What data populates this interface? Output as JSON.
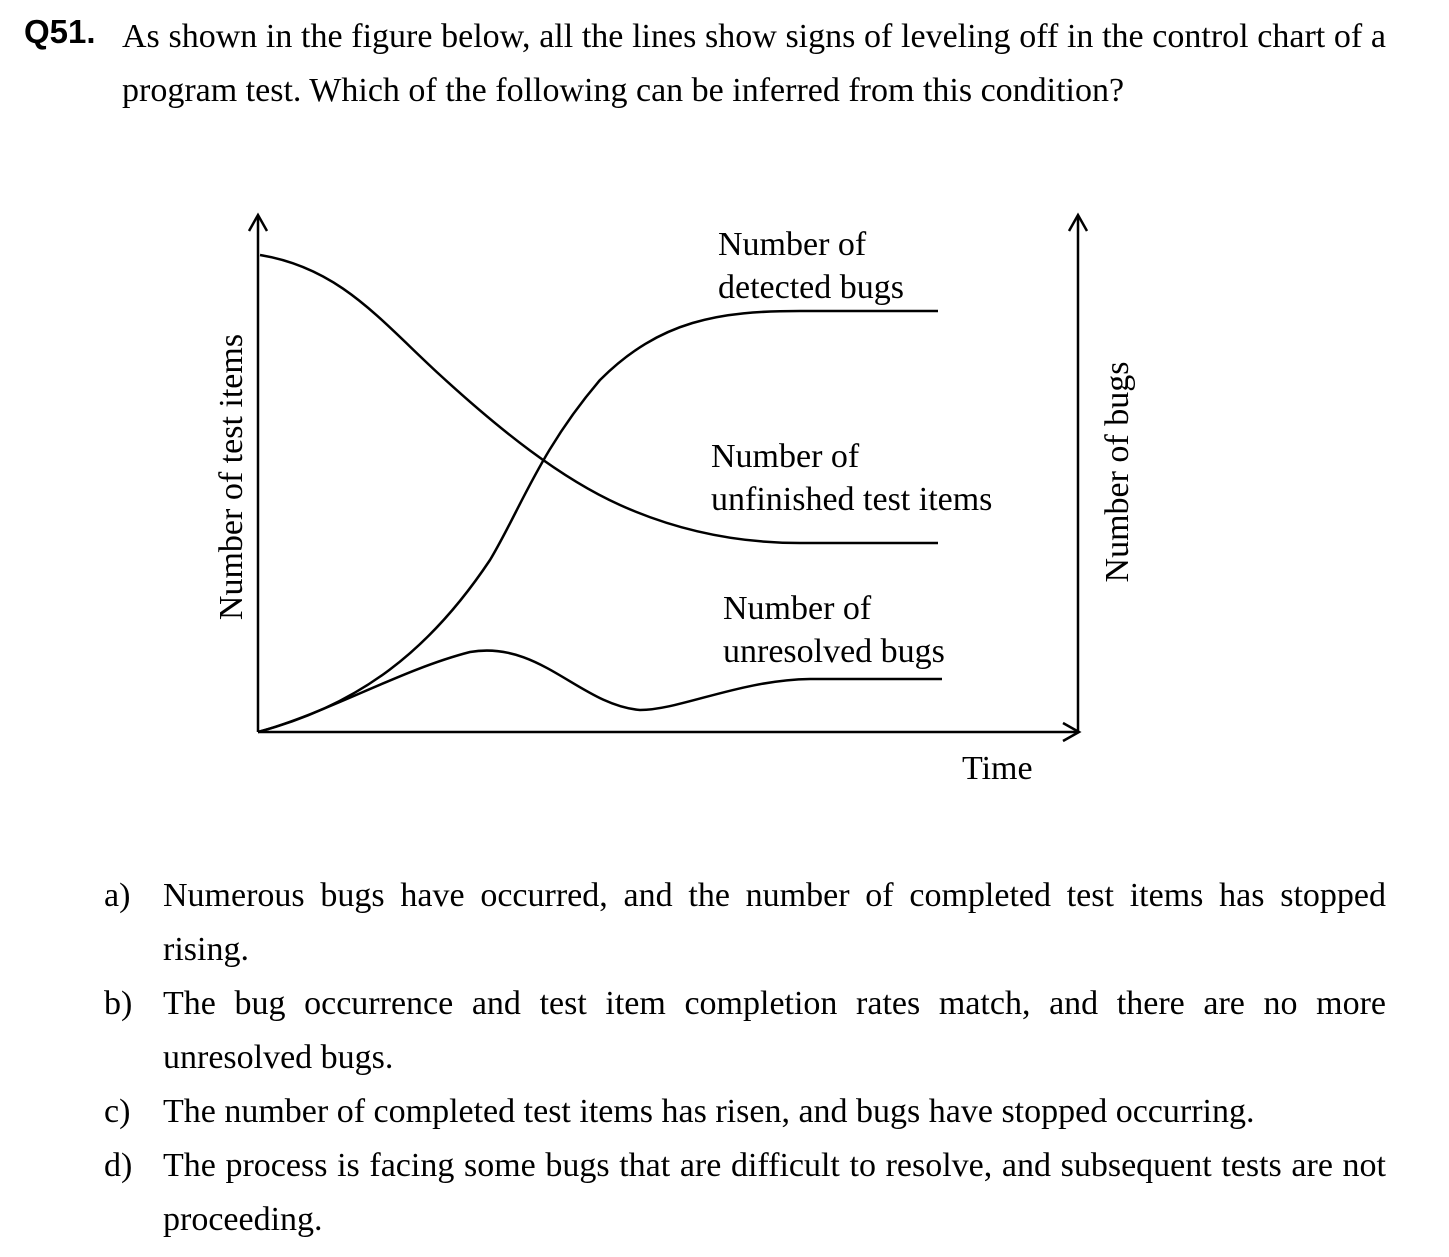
{
  "question": {
    "number": "Q51.",
    "text": "As shown in the figure below, all the lines show signs of leveling off in the control chart of a program test.    Which of the following can be inferred from this condition?"
  },
  "figure": {
    "left_axis_label": "Number of test items",
    "right_axis_label": "Number of bugs",
    "x_axis_label": "Time",
    "curves": [
      {
        "line1": "Number of",
        "line2": "detected bugs"
      },
      {
        "line1": "Number of",
        "line2": "unfinished test items"
      },
      {
        "line1": "Number of",
        "line2": "unresolved bugs"
      }
    ]
  },
  "options": [
    {
      "label": "a)",
      "text": "Numerous bugs have occurred, and the number of completed test items has stopped rising."
    },
    {
      "label": "b)",
      "text": "The bug occurrence and test item completion rates match, and there are no more unresolved bugs."
    },
    {
      "label": "c)",
      "text": "The number of completed test items has risen, and bugs have stopped occurring."
    },
    {
      "label": "d)",
      "text": "The process is facing some bugs that are difficult to resolve, and subsequent tests are not proceeding."
    }
  ]
}
